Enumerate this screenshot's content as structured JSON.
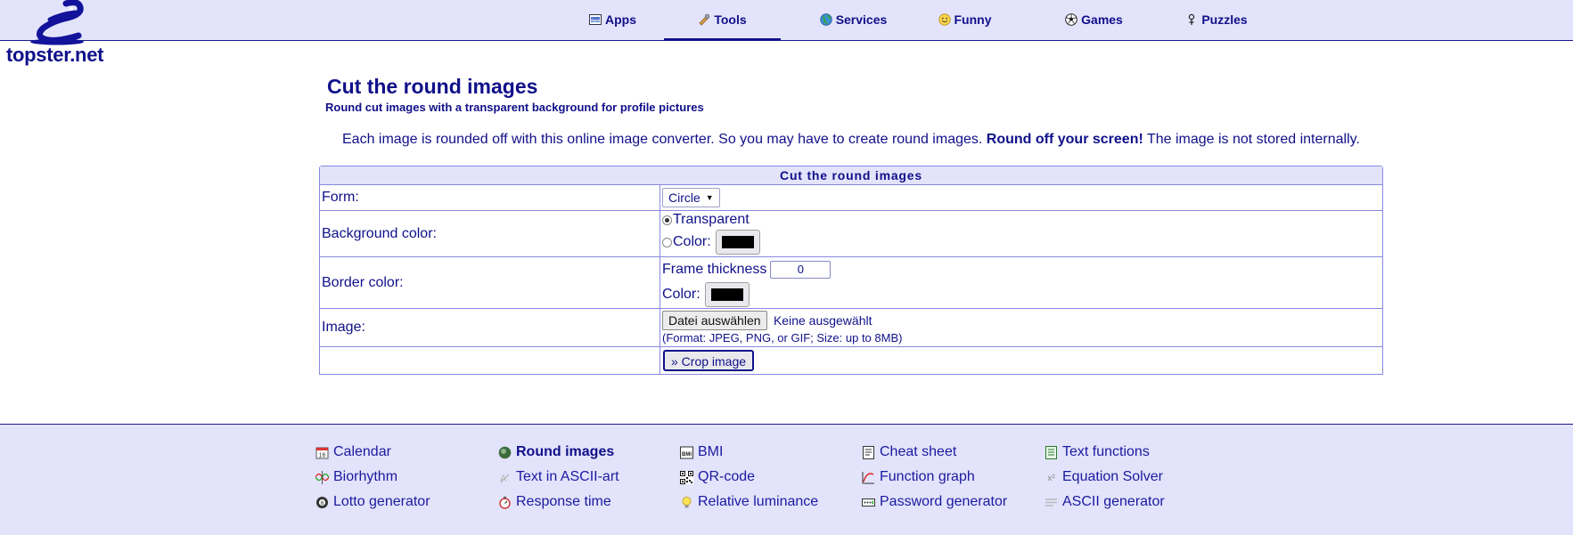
{
  "brand": {
    "name": "topster.net"
  },
  "nav": {
    "items": [
      {
        "label": "Apps",
        "icon": "apps-icon",
        "active": false
      },
      {
        "label": "Tools",
        "icon": "tools-icon",
        "active": true
      },
      {
        "label": "Services",
        "icon": "globe-icon",
        "active": false
      },
      {
        "label": "Funny",
        "icon": "smiley-icon",
        "active": false
      },
      {
        "label": "Games",
        "icon": "soccer-ball-icon",
        "active": false
      },
      {
        "label": "Puzzles",
        "icon": "puzzle-icon",
        "active": false
      }
    ]
  },
  "main": {
    "title": "Cut the round images",
    "subtitle": "Round cut images with a transparent background for profile pictures",
    "intro_text": "Each image is rounded off with this online image converter. So you may have to create round images. ",
    "intro_bold": "Round off your screen!",
    "intro_tail": " The image is not stored internally."
  },
  "form": {
    "caption": "Cut the round images",
    "form_label": "Form:",
    "form_value": "Circle",
    "background_label": "Background color:",
    "background_transparent": "Transparent",
    "background_color_label": "Color:",
    "background_color_value": "#000000",
    "border_label": "Border color:",
    "frame_thickness_label": "Frame thickness",
    "frame_thickness_value": "0",
    "border_color_label": "Color:",
    "border_color_value": "#000000",
    "image_label": "Image:",
    "file_button": "Datei auswählen",
    "file_status": "Keine ausgewählt",
    "image_hint": "(Format: JPEG, PNG, or GIF; Size: up to 8MB)",
    "submit_label": "» Crop image"
  },
  "footer": {
    "links": [
      {
        "label": "Calendar",
        "icon": "calendar-icon",
        "bold": false
      },
      {
        "label": "Biorhythm",
        "icon": "biorhythm-icon",
        "bold": false
      },
      {
        "label": "Lotto generator",
        "icon": "lotto-ball-icon",
        "bold": false
      },
      {
        "label": "Round images",
        "icon": "round-image-icon",
        "bold": true
      },
      {
        "label": "Text in ASCII-art",
        "icon": "ascii-art-icon",
        "bold": false
      },
      {
        "label": "Response time",
        "icon": "stopwatch-icon",
        "bold": false
      },
      {
        "label": "BMI",
        "icon": "bmi-icon",
        "bold": false
      },
      {
        "label": "QR-code",
        "icon": "qr-code-icon",
        "bold": false
      },
      {
        "label": "Relative luminance",
        "icon": "lightbulb-icon",
        "bold": false
      },
      {
        "label": "Cheat sheet",
        "icon": "cheat-sheet-icon",
        "bold": false
      },
      {
        "label": "Function graph",
        "icon": "function-graph-icon",
        "bold": false
      },
      {
        "label": "Password generator",
        "icon": "password-icon",
        "bold": false
      },
      {
        "label": "Text functions",
        "icon": "text-functions-icon",
        "bold": false
      },
      {
        "label": "Equation Solver",
        "icon": "equation-icon",
        "bold": false
      },
      {
        "label": "ASCII generator",
        "icon": "ascii-generator-icon",
        "bold": false
      }
    ]
  }
}
